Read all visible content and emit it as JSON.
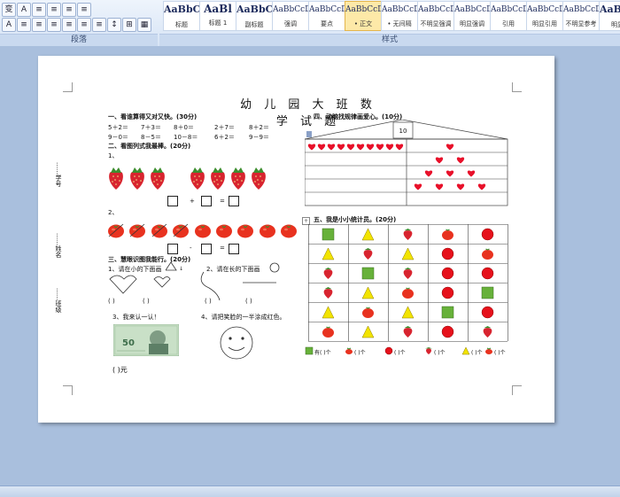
{
  "ribbon": {
    "paragraph_group": "段落",
    "styles_group": "样式",
    "styles": [
      {
        "preview": "AaBbC",
        "name": "标题"
      },
      {
        "preview": "AaBl",
        "name": "标题 1"
      },
      {
        "preview": "AaBbC",
        "name": "副标题"
      },
      {
        "preview": "AaBbCcDi",
        "name": "强调"
      },
      {
        "preview": "AaBbCcD",
        "name": "要点"
      },
      {
        "preview": "AaBbCcDc",
        "name": "• 正文"
      },
      {
        "preview": "AaBbCcDc",
        "name": "• 无间隔"
      },
      {
        "preview": "AaBbCcDi",
        "name": "不明显强调"
      },
      {
        "preview": "AaBbCcDc",
        "name": "明显强调"
      },
      {
        "preview": "AaBbCcDc",
        "name": "引用"
      },
      {
        "preview": "AaBbCcDc",
        "name": "明显引用"
      },
      {
        "preview": "AaBbCcDc",
        "name": "不明显参考"
      },
      {
        "preview": "AaBbC",
        "name": "明显"
      }
    ]
  },
  "doc": {
    "title": "幼 儿 园 大 班 数 学 试 题",
    "side_labels": [
      "学号",
      "姓名",
      "班级"
    ],
    "s1": {
      "heading": "一、看谁算得又对又快。(30分)",
      "row1": [
        "5＋2＝",
        "7＋3＝",
        "8＋0＝",
        "2＋7＝",
        "8＋2＝"
      ],
      "row2": [
        "9－0＝",
        "8－5＝",
        "10－8＝",
        "6＋2＝",
        "9－9＝"
      ]
    },
    "s2": {
      "heading": "二、看图列式我最棒。(20分)",
      "item1": "1、",
      "item2": "2、",
      "plus": "+",
      "minus": "-",
      "equals": "="
    },
    "s3": {
      "heading": "三、慧眼识图我能行。(20分)",
      "q1": "1、请在小的下面画",
      "q2": "2、请在长的下面画",
      "blanks": "(      )",
      "q3": "3、我来认一认！",
      "q4": "4、请把笑脸的一半涂成红色。",
      "answer": "(    )元",
      "banknote_value": "50"
    },
    "s4": {
      "heading": "四、动脑找规律画爱心。(10分)",
      "roof_number": "10"
    },
    "s5": {
      "heading": "五、我是小小统计员。(20分)",
      "grid": [
        [
          "square",
          "triangle",
          "strawberry",
          "tomato",
          "circle"
        ],
        [
          "triangle",
          "strawberry",
          "triangle",
          "circle",
          "tomato"
        ],
        [
          "strawberry",
          "square",
          "strawberry",
          "circle",
          "circle"
        ],
        [
          "strawberry",
          "triangle",
          "tomato",
          "circle",
          "square"
        ],
        [
          "triangle",
          "tomato",
          "triangle",
          "square",
          "circle"
        ],
        [
          "tomato",
          "triangle",
          "strawberry",
          "circle",
          "strawberry"
        ]
      ],
      "tally": [
        "有(  )个",
        "(  )个",
        "(  )个",
        "(  )个",
        "(  )个",
        "(  )个"
      ]
    }
  },
  "colors": {
    "strawberry": "#d8242f",
    "heart": "#e8102a",
    "triangle": "#f2e400",
    "square": "#67b13a",
    "circle": "#e6111b",
    "tomato": "#e8321f"
  }
}
